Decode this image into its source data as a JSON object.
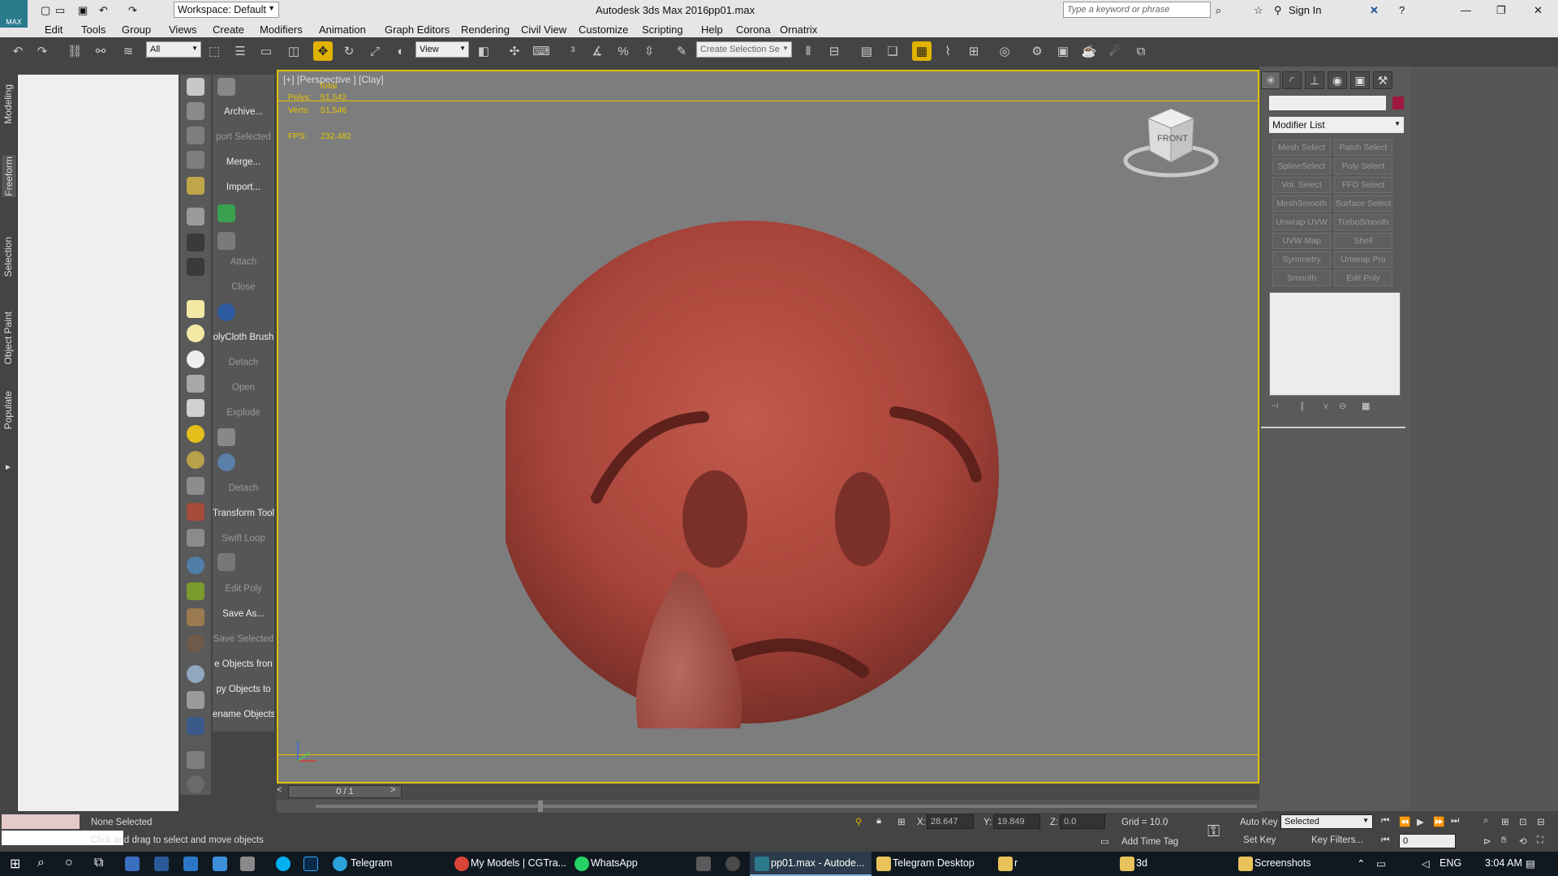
{
  "titlebar": {
    "workspace": "Workspace: Default",
    "app_title": "Autodesk 3ds Max 2016",
    "file": "pp01.max",
    "search_placeholder": "Type a keyword or phrase",
    "sign_in": "Sign In"
  },
  "menu": [
    "Edit",
    "Tools",
    "Group",
    "Views",
    "Create",
    "Modifiers",
    "Animation",
    "Graph Editors",
    "Rendering",
    "Civil View",
    "Customize",
    "Scripting",
    "Help",
    "Corona",
    "Ornatrix"
  ],
  "toolbar": {
    "filter_value": "All",
    "refcoord_value": "View",
    "selection_set_placeholder": "Create Selection Se"
  },
  "ribbon_tabs": [
    "Modeling",
    "Freeform",
    "Selection",
    "Object Paint",
    "Populate"
  ],
  "quick_tools": [
    {
      "label": "Archive...",
      "dim": false
    },
    {
      "label": "port Selected",
      "dim": true
    },
    {
      "label": "Merge...",
      "dim": false
    },
    {
      "label": "Import...",
      "dim": false
    },
    {
      "label": "Attach",
      "dim": true
    },
    {
      "label": "Close",
      "dim": true
    },
    {
      "label": "olyCloth Brush",
      "dim": false
    },
    {
      "label": "Detach",
      "dim": true
    },
    {
      "label": "Open",
      "dim": true
    },
    {
      "label": "Explode",
      "dim": true
    },
    {
      "label": "Detach",
      "dim": true
    },
    {
      "label": "Transform Tool",
      "dim": false
    },
    {
      "label": "Swift Loop",
      "dim": true
    },
    {
      "label": "Edit Poly",
      "dim": true
    },
    {
      "label": "Save As...",
      "dim": false
    },
    {
      "label": "Save Selected",
      "dim": true
    },
    {
      "label": "e Objects fron",
      "dim": false
    },
    {
      "label": "py Objects to",
      "dim": false
    },
    {
      "label": "ename Objects",
      "dim": false
    }
  ],
  "viewport": {
    "label": "[+] [Perspective ] [Clay]",
    "stats_header": "Total",
    "polys_label": "Polys:",
    "polys": "51,542",
    "verts_label": "Verts:",
    "verts": "51,546",
    "fps_label": "FPS:",
    "fps": "232.482",
    "viewcube_face": "FRONT",
    "model_color": "#b5473c"
  },
  "command_panel": {
    "modifier_list": "Modifier List",
    "object_color": "#a0173f",
    "modifier_buttons": [
      [
        "Mesh Select",
        "Patch Select"
      ],
      [
        "SplineSelect",
        "Poly Select"
      ],
      [
        "Vol. Select",
        "FFD Select"
      ],
      [
        "MeshSmooth",
        "Surface Select"
      ],
      [
        "Unwrap UVW",
        "TurboSmooth"
      ],
      [
        "UVW Map",
        "Shell"
      ],
      [
        "Symmetry",
        "Unwrap Pro"
      ],
      [
        "Smooth",
        "Edit Poly"
      ]
    ]
  },
  "timeline": {
    "frame": "0 / 1"
  },
  "status": {
    "selection": "None Selected",
    "prompt": "Click and drag to select and move objects",
    "x_label": "X:",
    "x": "28.647",
    "y_label": "Y:",
    "y": "19.849",
    "z_label": "Z:",
    "z": "0.0",
    "grid": "Grid = 10.0",
    "add_time_tag": "Add Time Tag",
    "auto_key": "Auto Key",
    "set_key": "Set Key",
    "key_mode": "Selected",
    "key_filters": "Key Filters...",
    "current_frame": "0"
  },
  "taskbar": {
    "apps": [
      "Telegram",
      "My Models | CGTra...",
      "WhatsApp",
      "pp01.max - Autode...",
      "Telegram Desktop",
      "r",
      "3d",
      "Screenshots"
    ],
    "lang": "ENG",
    "time": "3:04 AM"
  }
}
